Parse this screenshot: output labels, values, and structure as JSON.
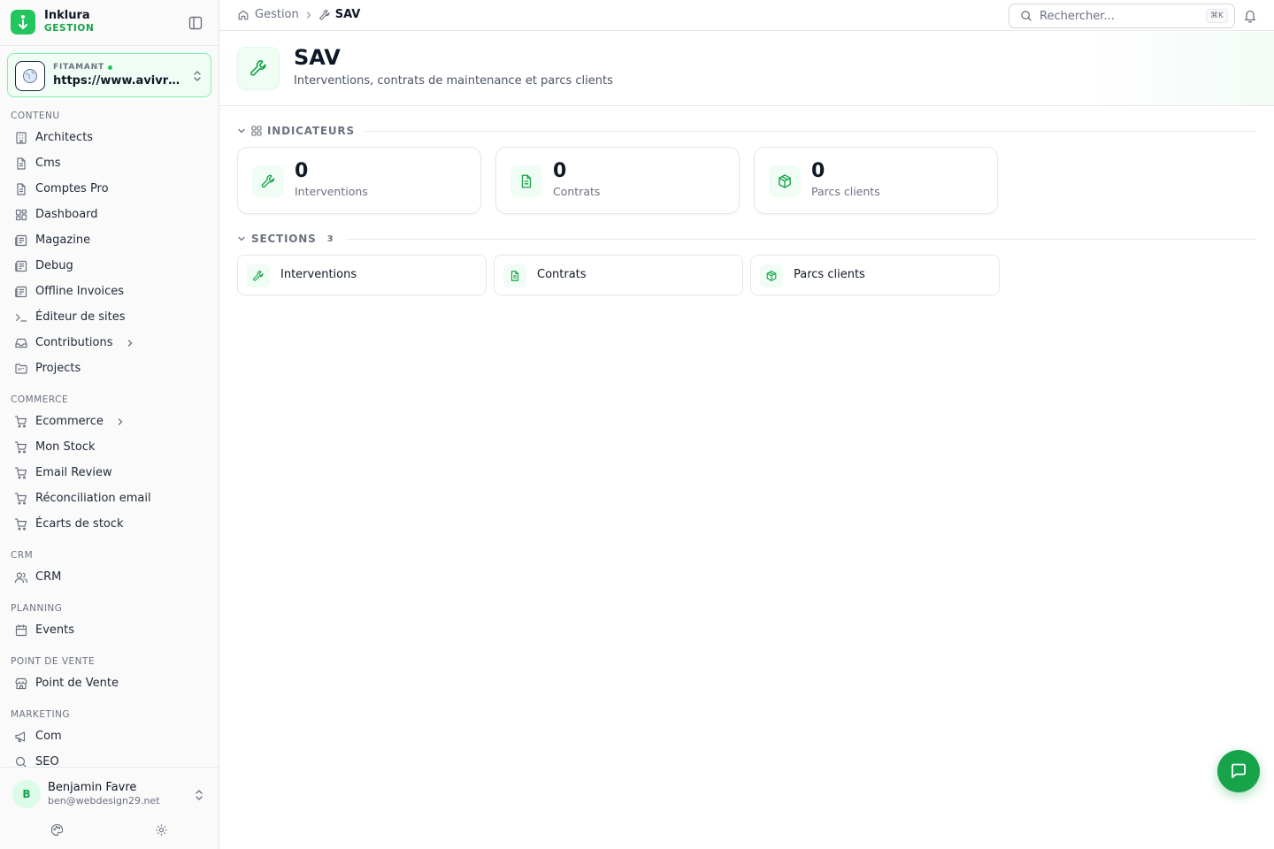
{
  "brand": {
    "name": "Inklura",
    "sub": "GESTION"
  },
  "site": {
    "label": "FITAMANT",
    "url": "https://www.avivre.fr"
  },
  "nav": {
    "contenu": {
      "title": "CONTENU",
      "items": [
        "Architects",
        "Cms",
        "Comptes Pro",
        "Dashboard",
        "Magazine",
        "Debug",
        "Offline Invoices",
        "Éditeur de sites",
        "Contributions",
        "Projects"
      ]
    },
    "commerce": {
      "title": "COMMERCE",
      "items": [
        "Ecommerce",
        "Mon Stock",
        "Email Review",
        "Réconciliation email",
        "Écarts de stock"
      ]
    },
    "crm": {
      "title": "CRM",
      "items": [
        "CRM"
      ]
    },
    "planning": {
      "title": "PLANNING",
      "items": [
        "Events"
      ]
    },
    "pos": {
      "title": "POINT DE VENTE",
      "items": [
        "Point de Vente"
      ]
    },
    "marketing": {
      "title": "MARKETING",
      "items": [
        "Com",
        "SEO"
      ]
    }
  },
  "user": {
    "initial": "B",
    "name": "Benjamin Favre",
    "email": "ben@webdesign29.net"
  },
  "breadcrumb": {
    "home": "Gestion",
    "current": "SAV"
  },
  "search": {
    "placeholder": "Rechercher...",
    "shortcut": "⌘K"
  },
  "page": {
    "title": "SAV",
    "subtitle": "Interventions, contrats de maintenance et parcs clients"
  },
  "indicators": {
    "title": "INDICATEURS",
    "items": [
      {
        "value": "0",
        "label": "Interventions",
        "icon": "wrench-icon"
      },
      {
        "value": "0",
        "label": "Contrats",
        "icon": "file-text-icon"
      },
      {
        "value": "0",
        "label": "Parcs clients",
        "icon": "package-icon"
      }
    ]
  },
  "sections": {
    "title": "SECTIONS",
    "count": "3",
    "items": [
      {
        "label": "Interventions",
        "icon": "wrench-icon"
      },
      {
        "label": "Contrats",
        "icon": "file-text-icon"
      },
      {
        "label": "Parcs clients",
        "icon": "package-icon"
      }
    ]
  },
  "colors": {
    "accent": "#22c55e",
    "accent_dark": "#16a34a",
    "accent_bg": "#f0fdf4"
  }
}
